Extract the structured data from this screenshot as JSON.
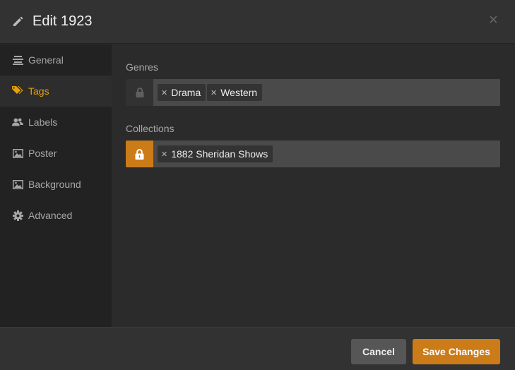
{
  "header": {
    "title": "Edit 1923",
    "close_glyph": "×"
  },
  "sidebar": {
    "items": [
      {
        "label": "General",
        "icon": "list-icon",
        "active": false
      },
      {
        "label": "Tags",
        "icon": "tag-icon",
        "active": true
      },
      {
        "label": "Labels",
        "icon": "users-icon",
        "active": false
      },
      {
        "label": "Poster",
        "icon": "image-icon",
        "active": false
      },
      {
        "label": "Background",
        "icon": "image-icon",
        "active": false
      },
      {
        "label": "Advanced",
        "icon": "gear-icon",
        "active": false
      }
    ]
  },
  "fields": {
    "genres": {
      "label": "Genres",
      "locked": false,
      "tags": [
        "Drama",
        "Western"
      ]
    },
    "collections": {
      "label": "Collections",
      "locked": true,
      "tags": [
        "1882 Sheridan Shows"
      ]
    }
  },
  "footer": {
    "cancel_label": "Cancel",
    "save_label": "Save Changes"
  },
  "colors": {
    "accent": "#cc7b19",
    "active_text": "#e5a00d"
  }
}
